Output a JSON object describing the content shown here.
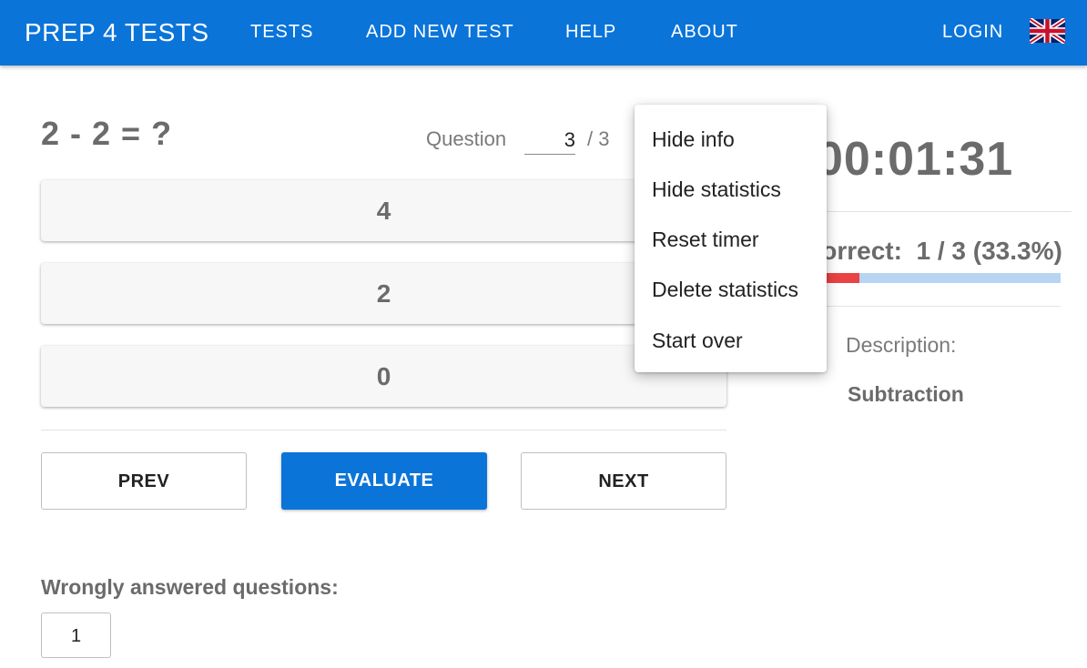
{
  "header": {
    "brand": "PREP 4 TESTS",
    "nav": [
      "TESTS",
      "ADD NEW TEST",
      "HELP",
      "ABOUT"
    ],
    "login": "LOGIN",
    "language_icon": "uk-flag-icon",
    "accent_color": "#0b74d9"
  },
  "question": {
    "text": "2 - 2 = ?",
    "counter_label": "Question",
    "current": "3",
    "total": "/ 3",
    "answers": [
      "4",
      "2",
      "0"
    ]
  },
  "buttons": {
    "prev": "PREV",
    "evaluate": "EVALUATE",
    "next": "NEXT"
  },
  "wrong": {
    "label": "Wrongly answered questions:",
    "items": [
      "1"
    ]
  },
  "stats": {
    "timer": "00:01:31",
    "correct_label": "Correct:",
    "correct_value": "1 / 3 (33.3%)",
    "correct_fraction": 0.15,
    "progress_fill_color": "#e94343",
    "progress_track_color": "#b7d5f2",
    "description_label": "Description:",
    "description_value": "Subtraction"
  },
  "menu": {
    "items": [
      "Hide info",
      "Hide statistics",
      "Reset timer",
      "Delete statistics",
      "Start over"
    ]
  }
}
